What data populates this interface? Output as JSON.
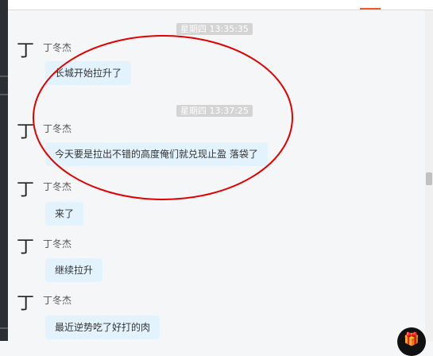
{
  "messages": [
    {
      "timestamp": "星期四 13:35:35",
      "sender": "丁冬杰",
      "avatar_char": "丁",
      "text": "长城开始拉升了"
    },
    {
      "timestamp": "星期四 13:37:25",
      "sender": "丁冬杰",
      "avatar_char": "丁",
      "text": "今天要是拉出不错的高度俺们就兑现止盈 落袋了"
    },
    {
      "timestamp": null,
      "sender": "丁冬杰",
      "avatar_char": "丁",
      "text": "来了"
    },
    {
      "timestamp": null,
      "sender": "丁冬杰",
      "avatar_char": "丁",
      "text": "继续拉升"
    },
    {
      "timestamp": null,
      "sender": "丁冬杰",
      "avatar_char": "丁",
      "text": "最近逆势吃了好打的肉"
    }
  ],
  "annotation": {
    "shape": "ellipse",
    "color": "#e00000"
  },
  "colors": {
    "bubble": "#e3f3fd",
    "timestamp_bg": "#d4d4d4",
    "accent": "#f25a29"
  },
  "icons": {
    "gift": "gift-icon"
  }
}
